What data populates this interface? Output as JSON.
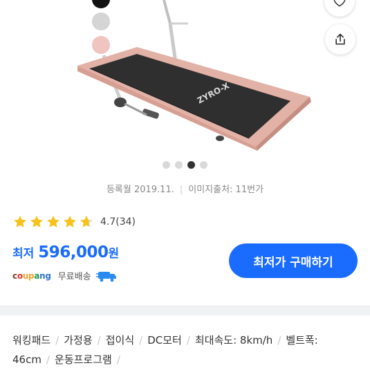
{
  "hero": {
    "brand_text": "ZYRO-X",
    "color_swatches": [
      "#111111",
      "#d5d5d5",
      "#f0c4bf"
    ],
    "icons": [
      "heart-icon",
      "share-icon"
    ]
  },
  "gallery": {
    "dots": 4,
    "active_index": 2
  },
  "meta": {
    "registered": "등록월 2019.11.",
    "image_source": "이미지출처: 11번가"
  },
  "rating": {
    "score": "4.7",
    "count": "(34)",
    "stars": 4.7
  },
  "price": {
    "label": "최저",
    "value": "596,000",
    "unit": "원"
  },
  "cta": {
    "label": "최저가 구매하기"
  },
  "seller": {
    "name": "coupang",
    "shipping": "무료배송",
    "badge": "로켓"
  },
  "specs": [
    "워킹패드",
    "가정용",
    "접이식",
    "DC모터",
    "최대속도: 8km/h",
    "벨트폭: 46cm",
    "운동프로그램"
  ],
  "colors": {
    "accent": "#1a6bff",
    "star": "#f7c21a"
  }
}
